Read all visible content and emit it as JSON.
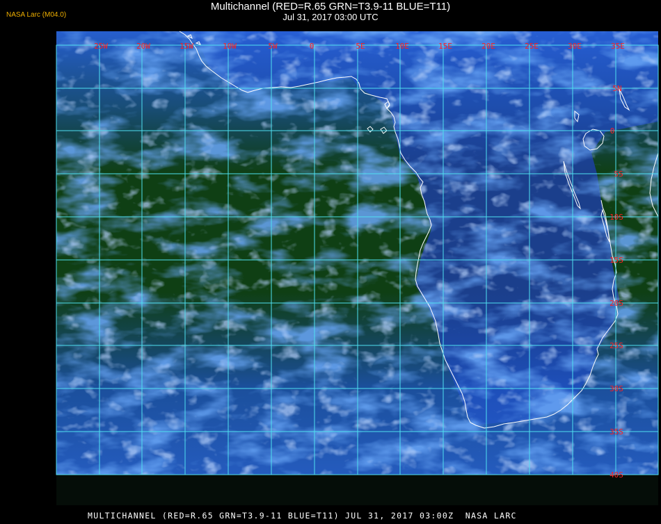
{
  "header": {
    "credit": "NASA Larc (M04.0)",
    "title": "Multichannel (RED=R.65 GRN=T3.9-11 BLUE=T11)",
    "subtitle": "Jul 31, 2017 03:00 UTC"
  },
  "map": {
    "lon_labels": [
      "25W",
      "20W",
      "15W",
      "10W",
      "5W",
      "0",
      "5E",
      "10E",
      "15E",
      "20E",
      "25E",
      "30E",
      "35E"
    ],
    "lat_labels": [
      "5N",
      "0",
      "5S",
      "10S",
      "15S",
      "20S",
      "25S",
      "30S",
      "35S",
      "40S"
    ],
    "colors": {
      "grid": "#4fe0f0",
      "label": "#ff2020",
      "coast": "#ffffff",
      "ocean_clear": "#0f3f14",
      "cloud_low": "#1f5acb",
      "cloud_high": "#6f98e8"
    }
  },
  "footer": {
    "caption": "MULTICHANNEL (RED=R.65 GRN=T3.9-11 BLUE=T11) JUL 31, 2017 03:00Z  NASA LARC"
  }
}
